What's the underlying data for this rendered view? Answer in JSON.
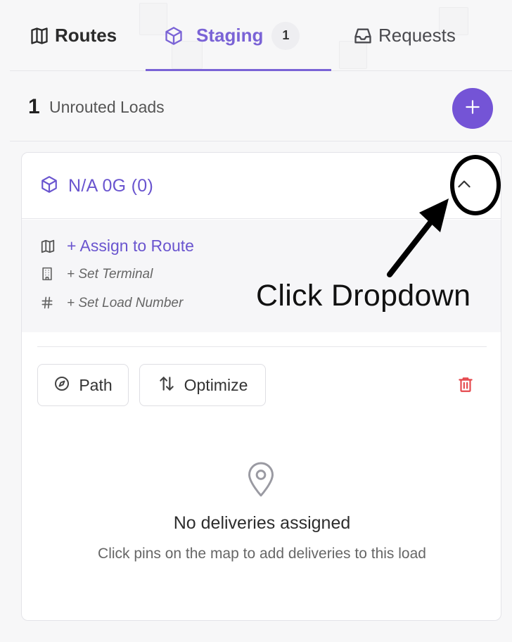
{
  "tabs": [
    {
      "label": "Routes",
      "icon": "map-icon"
    },
    {
      "label": "Staging",
      "icon": "cube-icon",
      "badge": "1",
      "active": true
    },
    {
      "label": "Requests",
      "icon": "inbox-icon"
    }
  ],
  "unrouted": {
    "count": "1",
    "label": "Unrouted Loads"
  },
  "load_card": {
    "title": "N/A 0G (0)",
    "assign_route": "+ Assign to Route",
    "set_terminal": "+ Set Terminal",
    "set_load_number": "+ Set Load Number",
    "path_button": "Path",
    "optimize_button": "Optimize",
    "empty_title": "No deliveries assigned",
    "empty_subtitle": "Click pins on the map to add deliveries to this load"
  },
  "annotation": {
    "text": "Click Dropdown"
  },
  "colors": {
    "accent": "#7454d6",
    "accent_text": "#6a55cf",
    "danger": "#e5484d"
  }
}
